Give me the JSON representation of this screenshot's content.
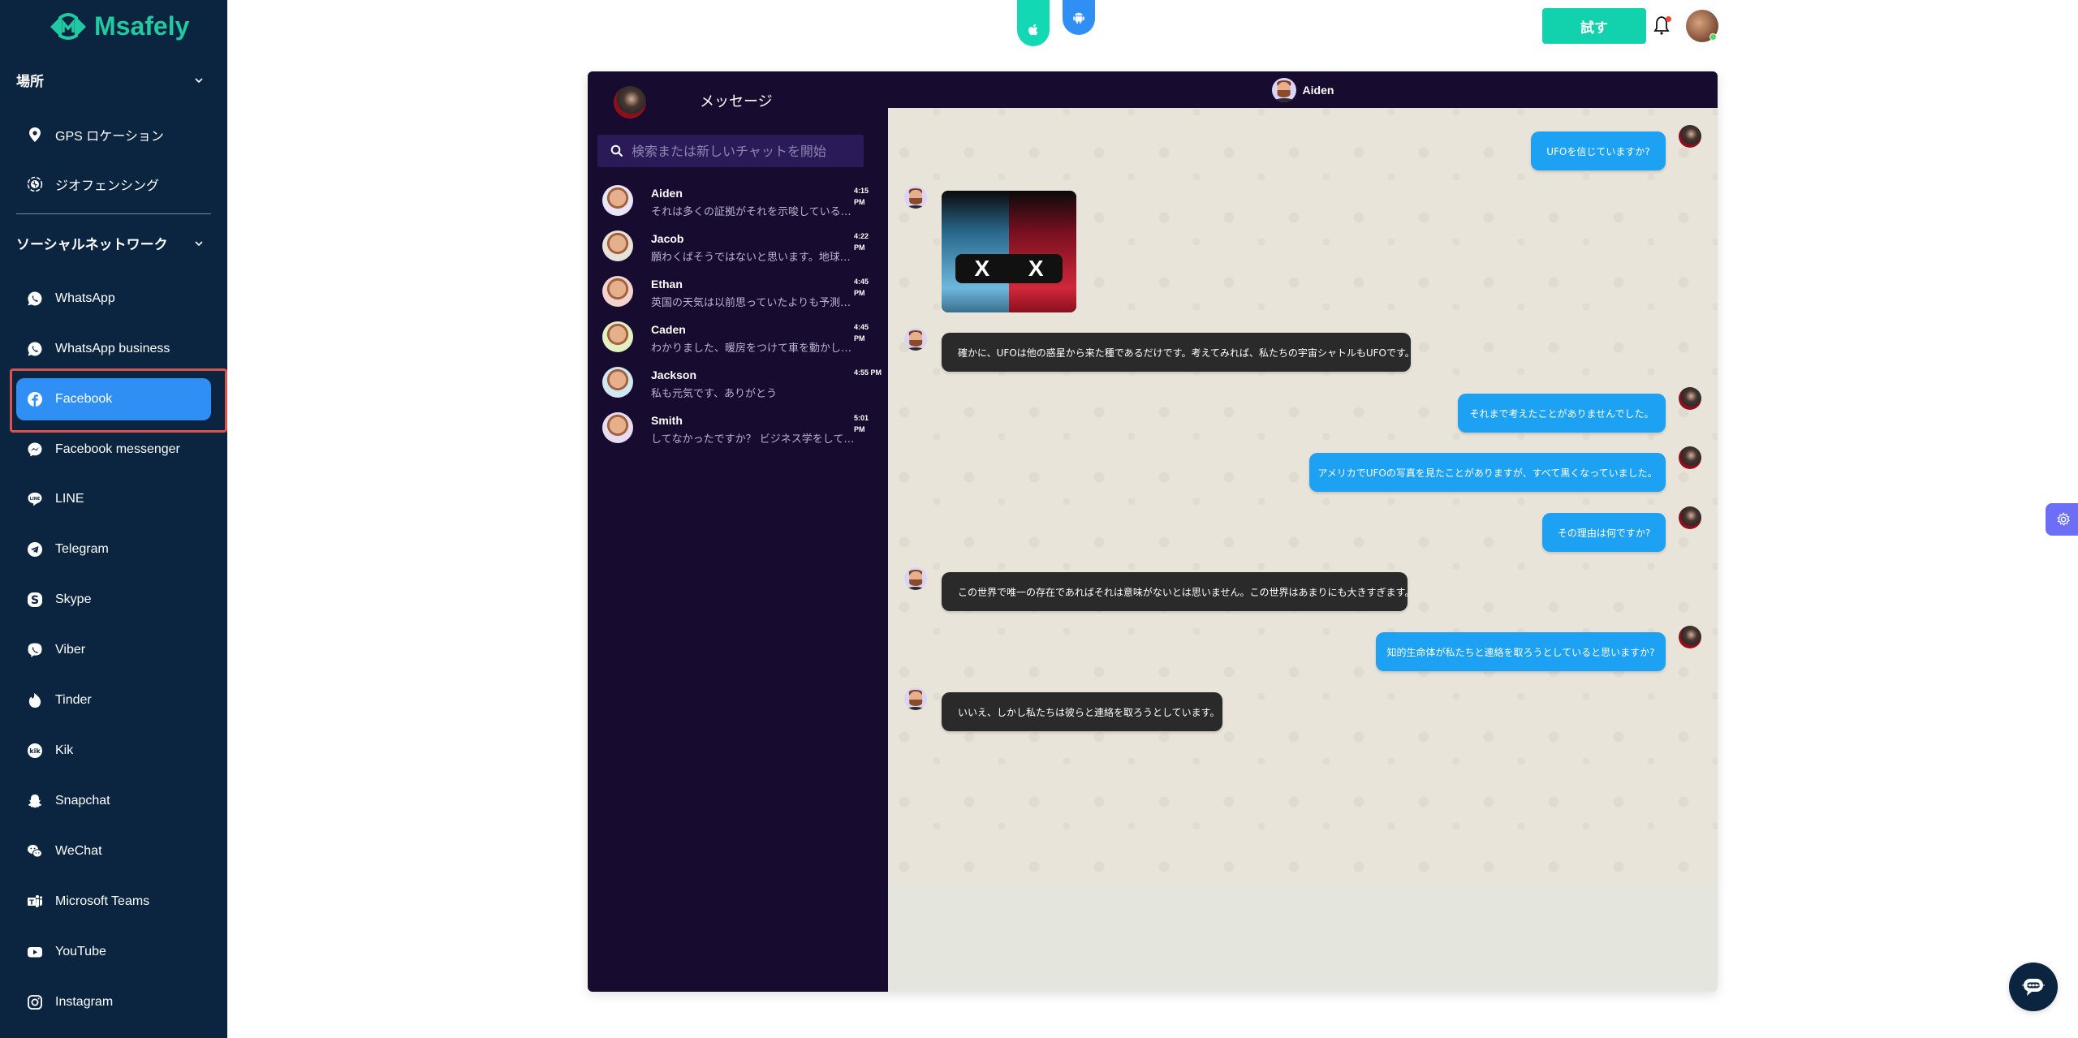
{
  "brand": {
    "name": "Msafely",
    "color": "#20c9a0"
  },
  "sidebar": {
    "sections": [
      {
        "title": "場所",
        "items": [
          {
            "label": "GPS ロケーション",
            "icon": "map-pin-icon"
          },
          {
            "label": "ジオフェンシング",
            "icon": "geofence-icon"
          }
        ]
      },
      {
        "title": "ソーシャルネットワーク",
        "items": [
          {
            "label": "WhatsApp",
            "icon": "whatsapp-icon"
          },
          {
            "label": "WhatsApp business",
            "icon": "whatsapp-business-icon"
          },
          {
            "label": "Facebook",
            "icon": "facebook-icon",
            "active": true
          },
          {
            "label": "Facebook messenger",
            "icon": "messenger-icon"
          },
          {
            "label": "LINE",
            "icon": "line-icon"
          },
          {
            "label": "Telegram",
            "icon": "telegram-icon"
          },
          {
            "label": "Skype",
            "icon": "skype-icon"
          },
          {
            "label": "Viber",
            "icon": "viber-icon"
          },
          {
            "label": "Tinder",
            "icon": "tinder-icon"
          },
          {
            "label": "Kik",
            "icon": "kik-icon"
          },
          {
            "label": "Snapchat",
            "icon": "snapchat-icon"
          },
          {
            "label": "WeChat",
            "icon": "wechat-icon"
          },
          {
            "label": "Microsoft Teams",
            "icon": "teams-icon"
          },
          {
            "label": "YouTube",
            "icon": "youtube-icon"
          },
          {
            "label": "Instagram",
            "icon": "instagram-icon"
          }
        ]
      }
    ]
  },
  "topbar": {
    "apple_store": "apple-icon",
    "android_store": "android-icon",
    "try_label": "試す",
    "notification_unread": true,
    "user_online": true
  },
  "messenger": {
    "list_title": "メッセージ",
    "search_placeholder": "検索または新しいチャットを開始",
    "conversations": [
      {
        "name": "Aiden",
        "preview": "それは多くの証拠がそれを示唆していることを",
        "time": "4:15 PM",
        "avatar_color": "#e9e4f7"
      },
      {
        "name": "Jacob",
        "preview": "願わくばそうではないと思います。地球に住んでいる",
        "time": "4:22 PM",
        "avatar_color": "#e8e1d8"
      },
      {
        "name": "Ethan",
        "preview": "英国の天気は以前思っていたよりも予測可能です",
        "time": "4:45 PM",
        "avatar_color": "#f4d3cc"
      },
      {
        "name": "Caden",
        "preview": "わかりました、暖房をつけて車を動かします",
        "time": "4:45 PM",
        "avatar_color": "#e2f0c4"
      },
      {
        "name": "Jackson",
        "preview": "私も元気です、ありがとう",
        "time": "4:55 PM",
        "avatar_color": "#cfe7f1"
      },
      {
        "name": "Smith",
        "preview": "してなかったですか？ ビジネス学をしていました",
        "time": "5:01 PM",
        "avatar_color": "#e7dcf0"
      }
    ],
    "active_chat": {
      "name": "Aiden",
      "messages": [
        {
          "dir": "out",
          "text": "UFOを信じていますか?"
        },
        {
          "dir": "in",
          "type": "image",
          "alt": "cat-with-sunglasses-image",
          "text": "X X"
        },
        {
          "dir": "in",
          "text": "確かに、UFOは他の惑星から来た種であるだけです。考えてみれば、私たちの宇宙シャトルもUFOです。"
        },
        {
          "dir": "out",
          "text": "それまで考えたことがありませんでした。"
        },
        {
          "dir": "out",
          "text": "アメリカでUFOの写真を見たことがありますが、すべて黒くなっていました。"
        },
        {
          "dir": "out",
          "text": "その理由は何ですか?"
        },
        {
          "dir": "in",
          "text": "この世界で唯一の存在であればそれは意味がないとは思いません。この世界はあまりにも大きすぎます。"
        },
        {
          "dir": "out",
          "text": "知的生命体が私たちと連絡を取ろうとしていると思いますか?"
        },
        {
          "dir": "in",
          "text": "いいえ、しかし私たちは彼らと連絡を取ろうとしています。"
        }
      ]
    }
  },
  "floating": {
    "settings": "gear-icon",
    "support_chat": "chat-bubble-icon"
  },
  "colors": {
    "sidebar_bg": "#0b2540",
    "active_item": "#2f8ff5",
    "outgoing_bubble": "#1da1f2",
    "incoming_bubble": "#2a2a2a",
    "list_bg": "#170b2f"
  }
}
